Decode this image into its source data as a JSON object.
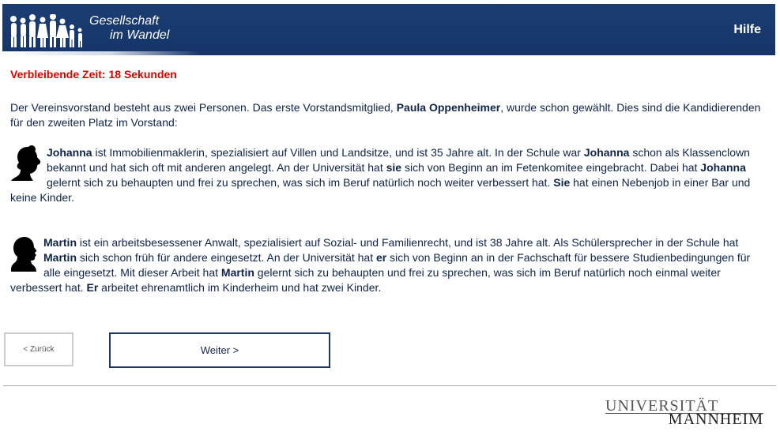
{
  "header": {
    "logo_line1": "Gesellschaft",
    "logo_line2": "im Wandel",
    "help_label": "Hilfe"
  },
  "timer": {
    "text": "Verbleibende Zeit: 18 Sekunden"
  },
  "intro": {
    "part1": "Der Vereinsvorstand besteht aus zwei Personen. Das erste Vorstandsmitglied, ",
    "name": "Paula Oppenheimer",
    "part2": ", wurde schon gewählt. Dies sind die Kandidierenden für den zweiten Platz im Vorstand:"
  },
  "candidates": {
    "johanna": {
      "name1": "Johanna",
      "t1": " ist Immobilienmaklerin, spezialisiert auf Villen und Landsitze, und ist 35 Jahre alt. In der Schule war ",
      "name2": "Johanna",
      "t2": " schon als Klassenclown bekannt und hat sich oft mit anderen angelegt. An der Universität hat ",
      "pron1": "sie",
      "t3": " sich von Beginn an im Fetenkomitee eingebracht. Dabei hat ",
      "name3": "Johanna",
      "t4": " gelernt sich zu behaupten und frei zu sprechen, was sich im Beruf natürlich noch weiter verbessert hat. ",
      "pron2": "Sie",
      "t5": " hat einen Nebenjob in einer Bar und keine Kinder."
    },
    "martin": {
      "name1": "Martin",
      "t1": " ist ein arbeitsbesessener Anwalt, spezialisiert auf Sozial- und Familienrecht, und ist 38 Jahre alt. Als Schülersprecher in der Schule hat ",
      "name2": "Martin",
      "t2": " sich schon früh für andere eingesetzt. An der Universität hat ",
      "pron1": "er",
      "t3": " sich von Beginn an in der Fachschaft für bessere Studienbedingungen für alle eingesetzt. Mit dieser Arbeit hat ",
      "name3": "Martin",
      "t4": " gelernt sich zu behaupten und frei zu sprechen, was sich im Beruf natürlich noch einmal weiter verbessert hat. ",
      "pron2": "Er",
      "t5": " arbeitet ehrenamtlich im Kinderheim und hat zwei Kinder."
    }
  },
  "nav": {
    "back_label": "< Zurück",
    "next_label": "Weiter >"
  },
  "footer": {
    "uni_line1": "UNIVERSITÄT",
    "uni_line2": "MANNHEIM"
  },
  "colors": {
    "header_bg": "#15356a",
    "timer": "#e00000",
    "text": "#0f2448"
  },
  "icons": [
    "people-silhouette-icon",
    "woman-profile-icon",
    "man-profile-icon"
  ]
}
